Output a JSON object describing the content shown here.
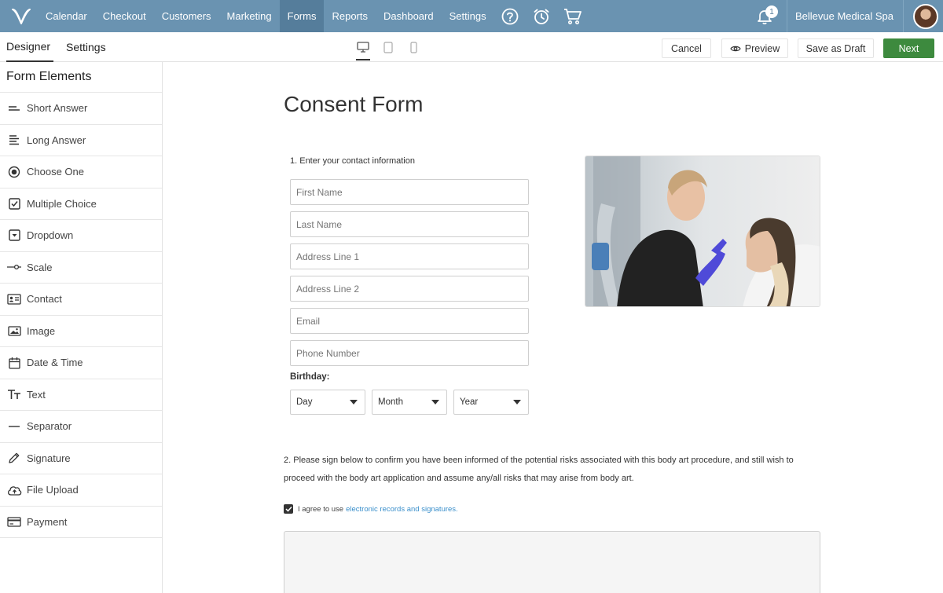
{
  "nav": {
    "items": [
      {
        "label": "Calendar",
        "active": false
      },
      {
        "label": "Checkout",
        "active": false
      },
      {
        "label": "Customers",
        "active": false
      },
      {
        "label": "Marketing",
        "active": false
      },
      {
        "label": "Forms",
        "active": true
      },
      {
        "label": "Reports",
        "active": false
      },
      {
        "label": "Dashboard",
        "active": false
      },
      {
        "label": "Settings",
        "active": false
      }
    ],
    "icons": [
      "help-circle-icon",
      "alarm-clock-icon",
      "shopping-cart-icon"
    ],
    "notification_count": "1",
    "business_name": "Bellevue Medical Spa",
    "accent_color": "#6a93b1",
    "active_color": "#557d9b"
  },
  "toolbar": {
    "tabs": [
      {
        "label": "Designer",
        "active": true
      },
      {
        "label": "Settings",
        "active": false
      }
    ],
    "devices": [
      "desktop-icon",
      "tablet-icon",
      "mobile-icon"
    ],
    "cancel_label": "Cancel",
    "preview_label": "Preview",
    "draft_label": "Save as Draft",
    "next_label": "Next",
    "primary_color": "#3d8a3e"
  },
  "sidebar": {
    "title": "Form Elements",
    "items": [
      {
        "label": "Short Answer",
        "icon": "short-answer-icon"
      },
      {
        "label": "Long Answer",
        "icon": "long-answer-icon"
      },
      {
        "label": "Choose One",
        "icon": "radio-icon"
      },
      {
        "label": "Multiple Choice",
        "icon": "checkbox-icon"
      },
      {
        "label": "Dropdown",
        "icon": "dropdown-icon"
      },
      {
        "label": "Scale",
        "icon": "scale-icon"
      },
      {
        "label": "Contact",
        "icon": "contact-card-icon"
      },
      {
        "label": "Image",
        "icon": "image-icon"
      },
      {
        "label": "Date & Time",
        "icon": "calendar-icon"
      },
      {
        "label": "Text",
        "icon": "text-icon"
      },
      {
        "label": "Separator",
        "icon": "separator-icon"
      },
      {
        "label": "Signature",
        "icon": "pencil-icon"
      },
      {
        "label": "File Upload",
        "icon": "cloud-upload-icon"
      },
      {
        "label": "Payment",
        "icon": "credit-card-icon"
      }
    ]
  },
  "form": {
    "title": "Consent Form",
    "question1": "1. Enter your contact information",
    "fields": [
      {
        "placeholder": "First Name"
      },
      {
        "placeholder": "Last Name"
      },
      {
        "placeholder": "Address Line 1"
      },
      {
        "placeholder": "Address Line 2"
      },
      {
        "placeholder": "Email"
      },
      {
        "placeholder": "Phone Number"
      }
    ],
    "birthday_label": "Birthday:",
    "birthday_selects": [
      {
        "value": "Day"
      },
      {
        "value": "Month"
      },
      {
        "value": "Year"
      }
    ],
    "question2": "2. Please sign below to confirm you have been informed of the potential risks associated with this body art procedure, and still wish to proceed with the body art application and assume any/all risks that may arise from body art.",
    "agree_text": "I agree to use",
    "agree_link": "electronic records and signatures.",
    "link_color": "#3a8fcb"
  }
}
